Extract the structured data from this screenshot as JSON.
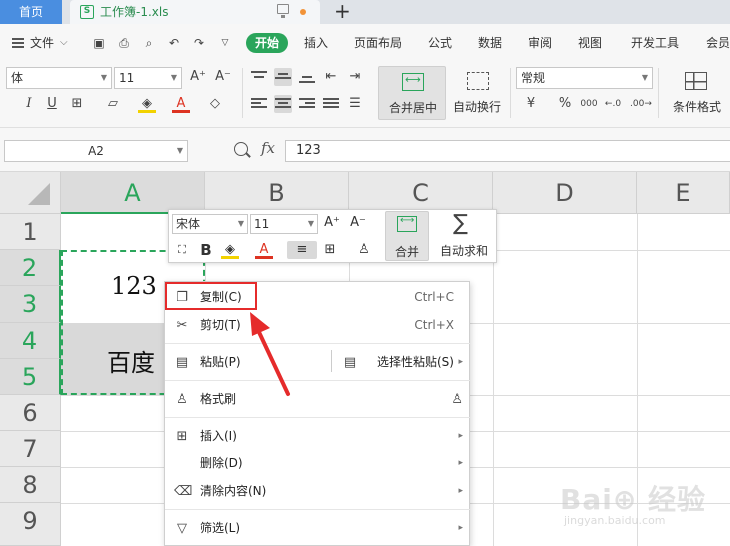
{
  "tabs": {
    "home_label": "首页",
    "file_name": "工作簿-1.xls",
    "file_icon_letter": "S",
    "new_tab_symbol": "+"
  },
  "menu": {
    "file_label": "文件",
    "file_chevron": "⌵",
    "start_label": "开始",
    "items": [
      "插入",
      "页面布局",
      "公式",
      "数据",
      "审阅",
      "视图",
      "开发工具",
      "会员"
    ]
  },
  "ribbon": {
    "font_name": "体",
    "font_size": "11",
    "increase_font": "A⁺",
    "decrease_font": "A⁻",
    "italic": "I",
    "underline": "U",
    "number_format": "常规",
    "merge_label": "合并居中",
    "wrap_label": "自动换行",
    "cond_format_label": "条件格式",
    "currency": "¥",
    "percent": "%",
    "thousands": "000"
  },
  "formula_bar": {
    "cell_ref": "A2",
    "fx_symbol": "fx",
    "content": "123"
  },
  "grid": {
    "columns": [
      "A",
      "B",
      "C",
      "D",
      "E"
    ],
    "rows": [
      "1",
      "2",
      "3",
      "4",
      "5",
      "6",
      "7",
      "8",
      "9"
    ],
    "cells": {
      "a23": "123",
      "a45": "百度"
    }
  },
  "mini_toolbar": {
    "font_name": "宋体",
    "font_size": "11",
    "increase_font": "A⁺",
    "decrease_font": "A⁻",
    "bold": "B",
    "font_color": "A",
    "merge_label": "合并",
    "autosum_label": "自动求和",
    "sigma": "∑"
  },
  "context_menu": {
    "items": [
      {
        "label": "复制(C)",
        "shortcut": "Ctrl+C",
        "icon": "copy-icon"
      },
      {
        "label": "剪切(T)",
        "shortcut": "Ctrl+X",
        "icon": "scissors-icon"
      },
      {
        "label": "粘贴(P)",
        "icon": "paste-icon"
      },
      {
        "label": "格式刷",
        "icon": "format-brush-icon"
      },
      {
        "label": "插入(I)",
        "icon": "insert-icon"
      },
      {
        "label": "删除(D)"
      },
      {
        "label": "清除内容(N)",
        "icon": "eraser-icon"
      },
      {
        "label": "筛选(L)",
        "icon": "filter-icon"
      }
    ],
    "paste_special_label": "选择性粘贴(S)",
    "submenu_arrow": "▸"
  },
  "watermark": {
    "brand": "Bai⊕ 经验",
    "site": "jingyan.baidu.com"
  },
  "colors": {
    "accent_green": "#2aa55b",
    "tab_blue": "#4a8ee0",
    "highlight_red": "#e52b2b",
    "selected_gray": "#d9d9d9"
  }
}
